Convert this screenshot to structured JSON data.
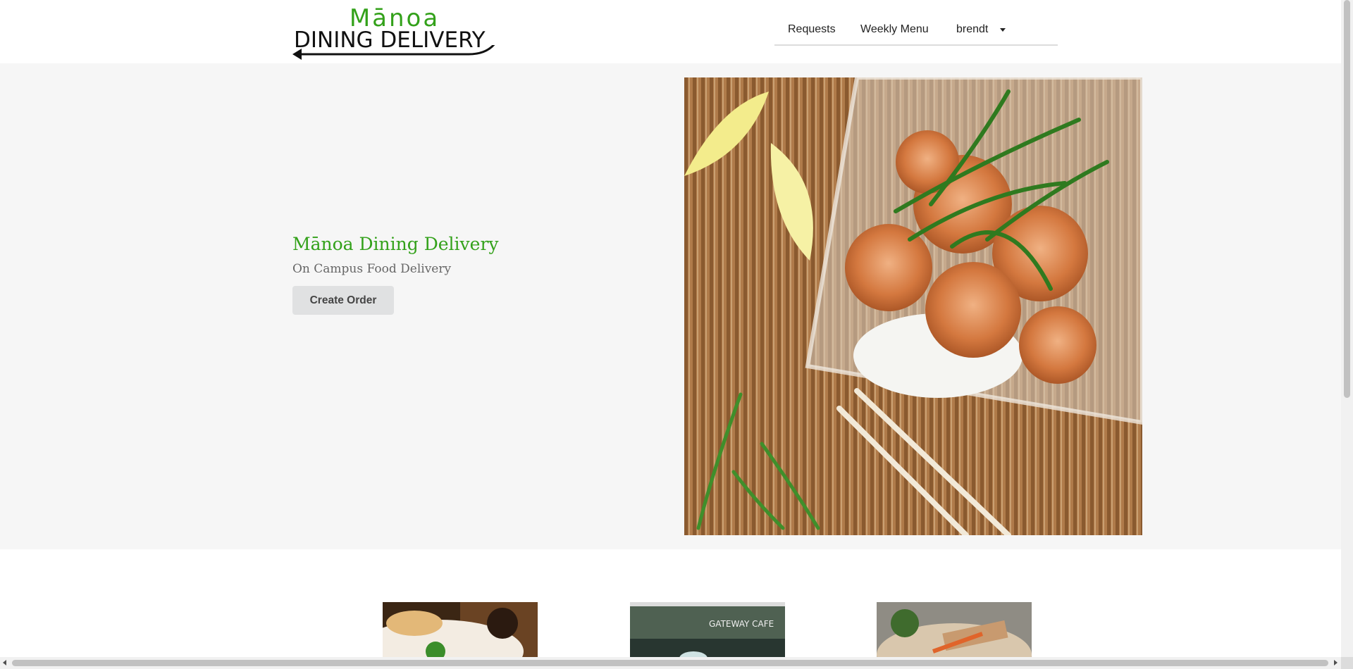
{
  "logo": {
    "line1": "Mānoa",
    "line2": "DINING DELIVERY"
  },
  "nav": {
    "requests": "Requests",
    "weekly_menu": "Weekly Menu",
    "user": "brendt"
  },
  "hero": {
    "title": "Mānoa Dining Delivery",
    "subtitle": "On Campus Food Delivery",
    "button": "Create Order"
  },
  "thumbnails": {
    "gateway_sign": "GATEWAY CAFE"
  },
  "colors": {
    "brand_green": "#33a11a",
    "hero_bg": "#f6f6f6",
    "button_bg": "#e0e1e2"
  }
}
